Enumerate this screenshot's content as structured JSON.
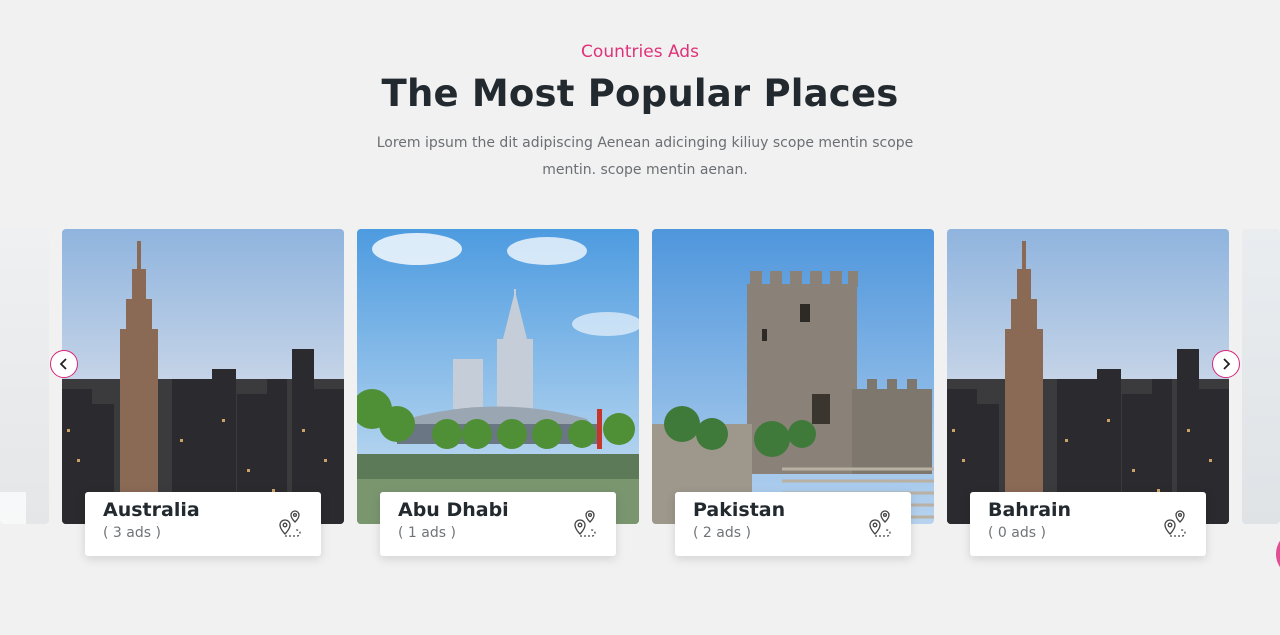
{
  "section": {
    "eyebrow": "Countries Ads",
    "title": "The Most Popular Places",
    "description": "Lorem ipsum the dit adipiscing Aenean adicinging kiliuy scope mentin scope mentin. scope mentin aenan."
  },
  "carousel": {
    "prev_icon": "chevron-left-icon",
    "next_icon": "chevron-right-icon",
    "cards": [
      {
        "name": "Australia",
        "count": "( 3 ads )",
        "image": "city-skyline-photo"
      },
      {
        "name": "Abu Dhabi",
        "count": "( 1 ads )",
        "image": "modern-building-lake-photo"
      },
      {
        "name": "Pakistan",
        "count": "( 2 ads )",
        "image": "stone-castle-tower-photo"
      },
      {
        "name": "Bahrain",
        "count": "( 0 ads )",
        "image": "city-skyline-photo"
      }
    ]
  },
  "colors": {
    "accent": "#e0327a",
    "heading": "#22292f",
    "background": "#f1f1f1"
  }
}
